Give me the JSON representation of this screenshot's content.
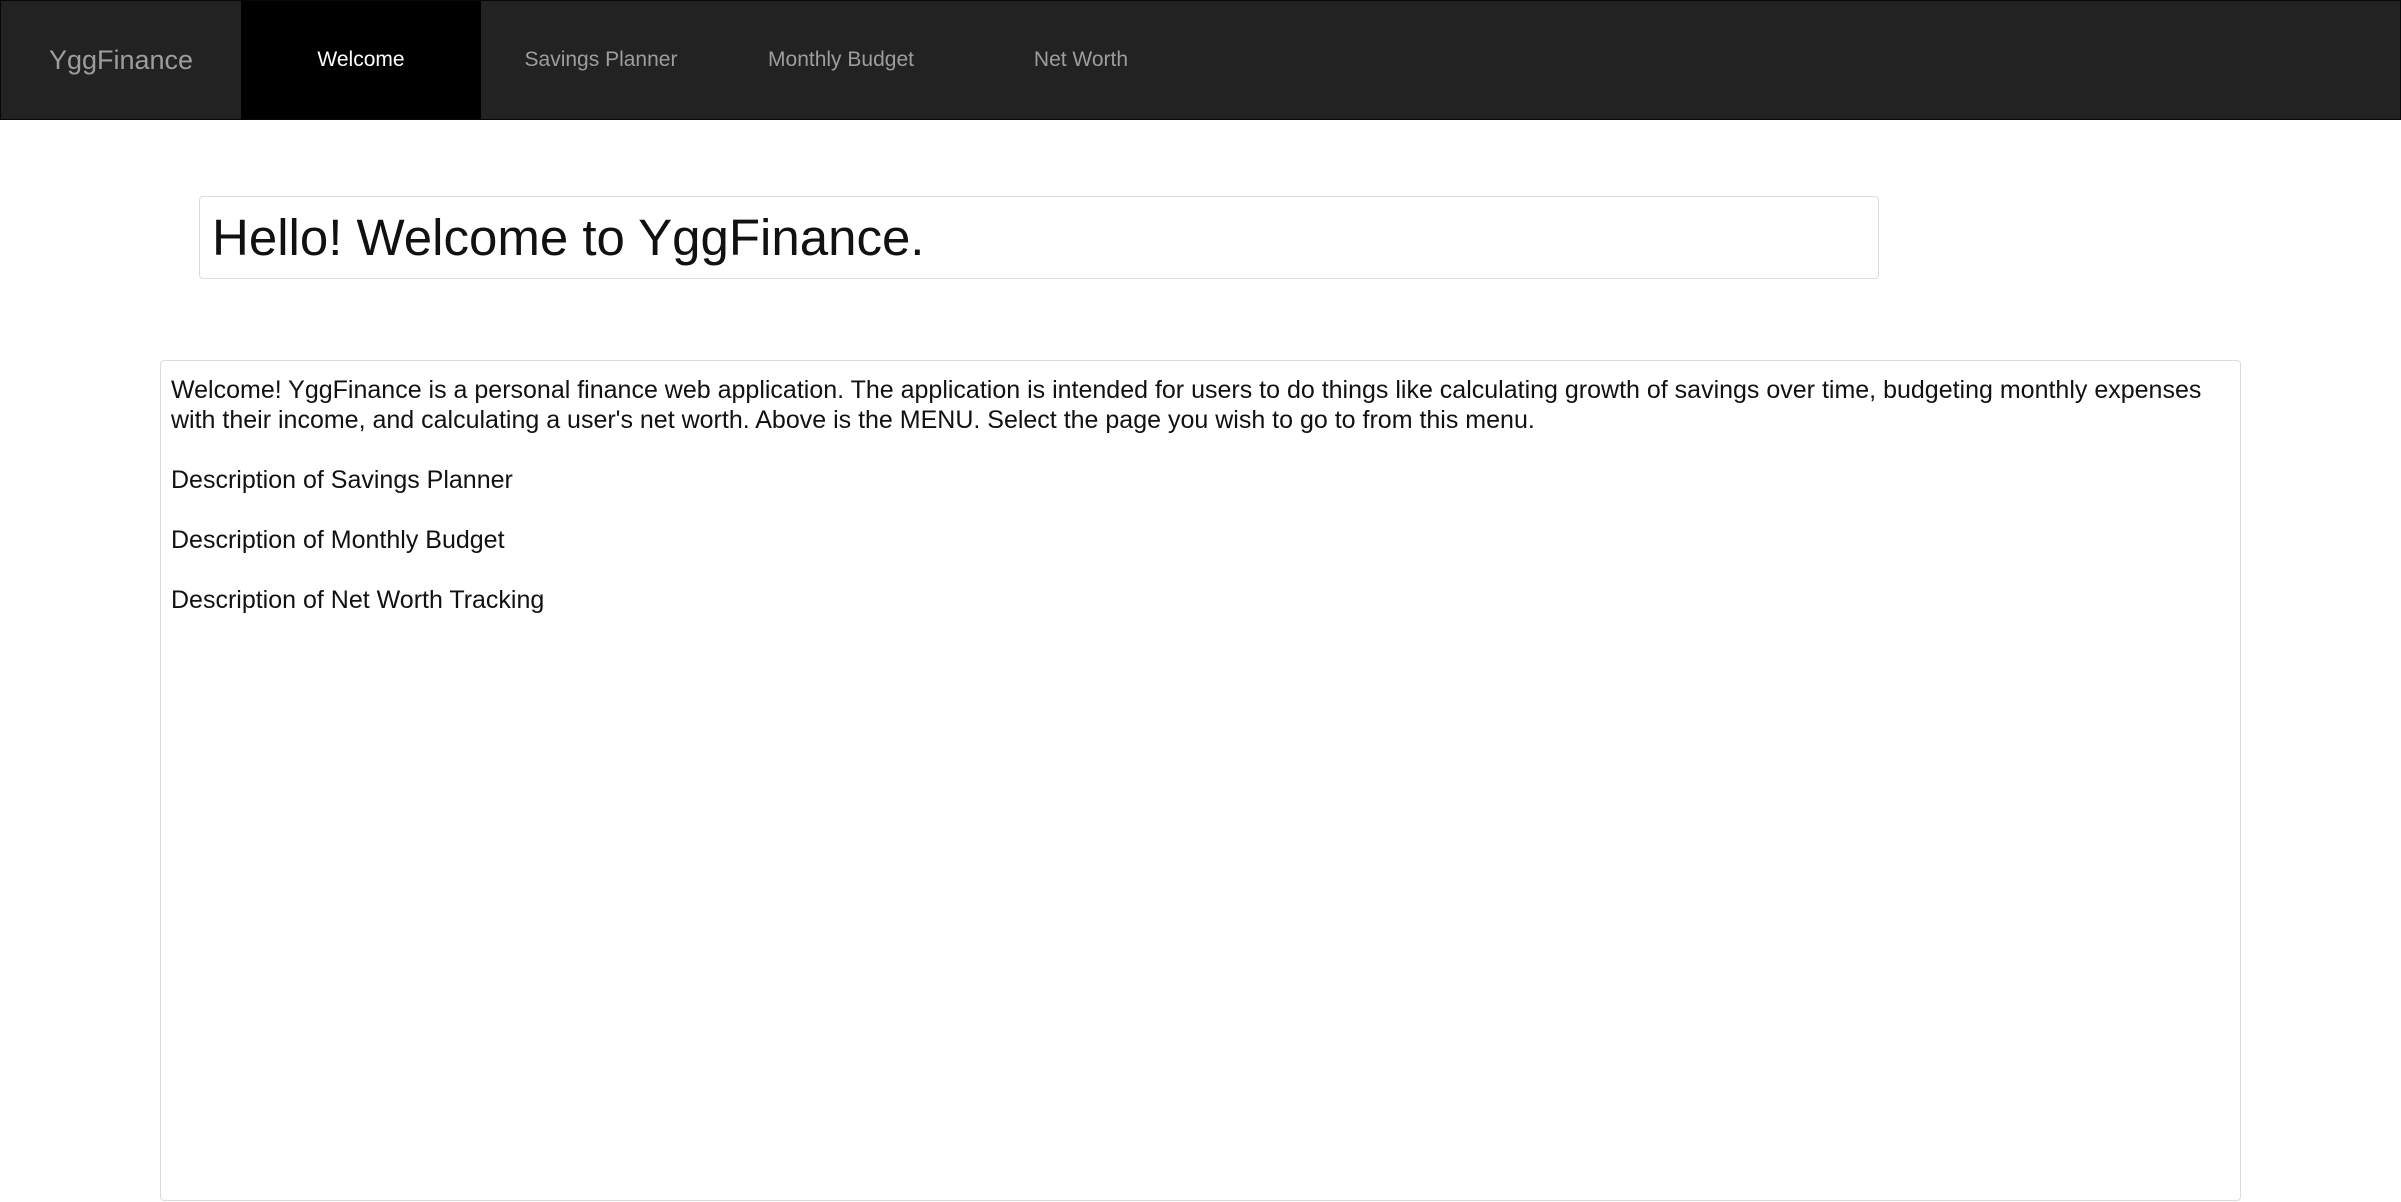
{
  "navbar": {
    "brand": "YggFinance",
    "items": [
      {
        "label": "Welcome",
        "active": true
      },
      {
        "label": "Savings Planner",
        "active": false
      },
      {
        "label": "Monthly Budget",
        "active": false
      },
      {
        "label": "Net Worth",
        "active": false
      }
    ]
  },
  "main": {
    "heading": "Hello! Welcome to YggFinance.",
    "intro": "Welcome! YggFinance is a personal finance web application. The application is intended for users to do things like calculating growth of savings over time, budgeting monthly expenses with their income, and calculating a user's net worth. Above is the MENU. Select the page you wish to go to from this menu.",
    "descriptions": [
      "Description of Savings Planner",
      "Description of Monthly Budget",
      "Description of Net Worth Tracking"
    ]
  },
  "colors": {
    "navbar_bg": "#222222",
    "active_tab_bg": "#000000",
    "nav_text": "#9d9d9d",
    "active_text": "#ffffff"
  }
}
